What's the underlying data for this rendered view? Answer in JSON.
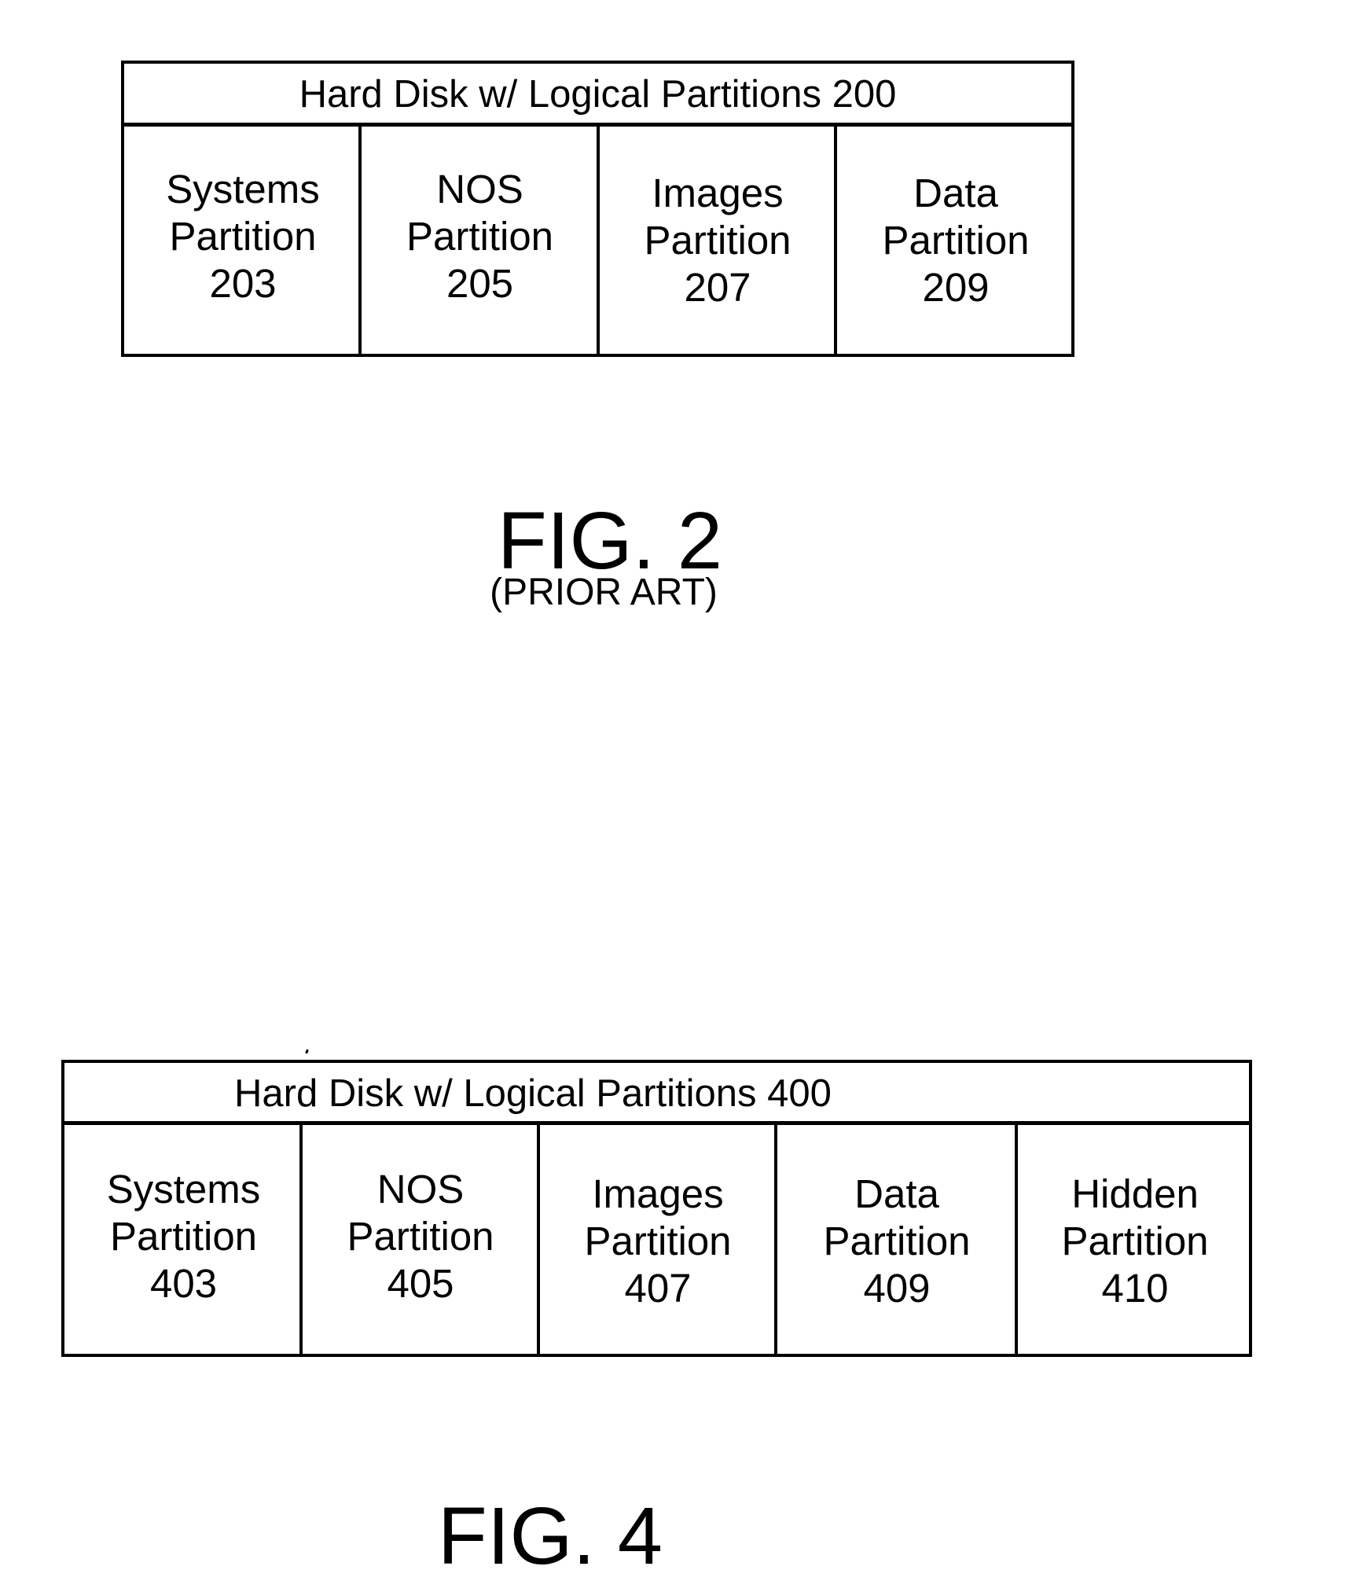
{
  "figures": [
    {
      "id": "fig2",
      "disk_title": "Hard Disk w/ Logical Partitions 200",
      "partitions": [
        {
          "name": "Systems",
          "word": "Partition",
          "ref": "203"
        },
        {
          "name": "NOS",
          "word": "Partition",
          "ref": "205"
        },
        {
          "name": "Images",
          "word": "Partition",
          "ref": "207"
        },
        {
          "name": "Data",
          "word": "Partition",
          "ref": "209"
        }
      ],
      "caption": "FIG. 2",
      "subcaption": "(PRIOR ART)"
    },
    {
      "id": "fig4",
      "disk_title": "Hard Disk w/ Logical Partitions 400",
      "partitions": [
        {
          "name": "Systems",
          "word": "Partition",
          "ref": "403"
        },
        {
          "name": "NOS",
          "word": "Partition",
          "ref": "405"
        },
        {
          "name": "Images",
          "word": "Partition",
          "ref": "407"
        },
        {
          "name": "Data",
          "word": "Partition",
          "ref": "409"
        },
        {
          "name": "Hidden",
          "word": "Partition",
          "ref": "410"
        }
      ],
      "caption": "FIG. 4"
    }
  ]
}
